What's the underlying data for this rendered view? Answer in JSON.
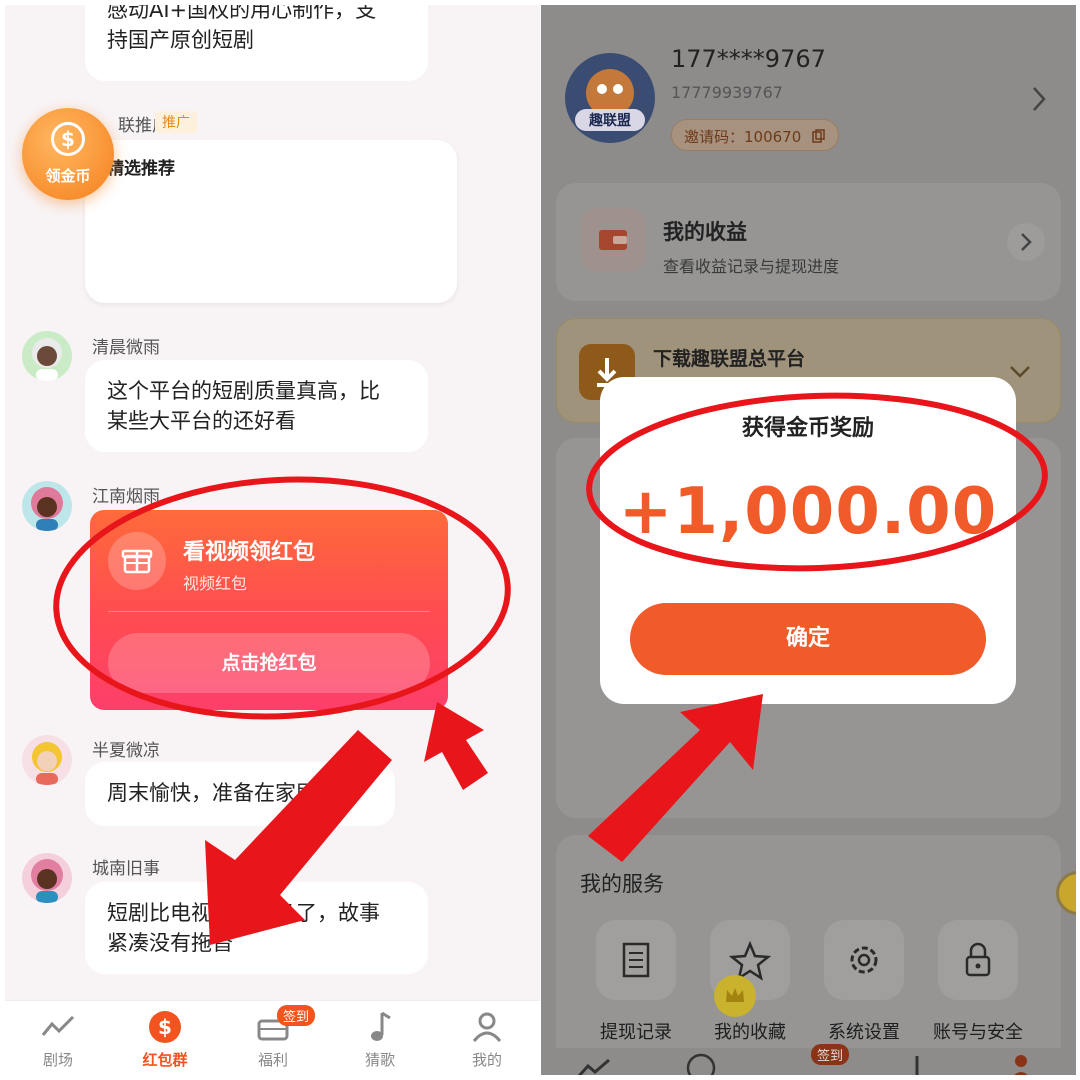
{
  "left": {
    "messages": [
      {
        "user": "",
        "text": "感动AI+国权的用心制作，支持国产原创短剧",
        "text_line2": "持国产原创短剧"
      },
      {
        "user": "联推广",
        "tag": "推广",
        "text": "精选推荐"
      },
      {
        "user": "清晨微雨",
        "text_line1": "这个平台的短剧质量真高，比",
        "text_line2": "某些大平台的还好看"
      },
      {
        "user": "江南烟雨"
      },
      {
        "user": "半夏微凉",
        "text": "周末愉快，准备在家刷短剧"
      },
      {
        "user": "城南旧事",
        "text_line1": "短剧比电视剧好看多了，故事",
        "text_line2": "紧凑没有拖沓"
      }
    ],
    "coin_fab": {
      "symbol": "$",
      "label": "领金币"
    },
    "red_packet": {
      "title": "看视频领红包",
      "subtitle": "视频红包",
      "button": "点击抢红包"
    },
    "tabs": [
      {
        "label": "剧场",
        "icon": "trend-icon"
      },
      {
        "label": "红包群",
        "icon": "dollar-icon",
        "active": true
      },
      {
        "label": "福利",
        "icon": "ticket-icon",
        "badge": "签到"
      },
      {
        "label": "猜歌",
        "icon": "music-note-icon"
      },
      {
        "label": "我的",
        "icon": "person-icon"
      }
    ]
  },
  "right": {
    "profile": {
      "phone_masked": "177****9767",
      "phone": "17779939767",
      "avatar_text": "趣联盟",
      "invite_code": "邀请码：100670"
    },
    "earnings": {
      "title": "我的收益",
      "subtitle": "查看收益记录与提现进度"
    },
    "download": {
      "title": "下载趣联盟总平台"
    },
    "services": {
      "title": "我的服务",
      "items": [
        "提现记录",
        "我的收藏",
        "系统设置",
        "账号与安全"
      ]
    },
    "bottom_badge": "签到"
  },
  "modal": {
    "title": "获得金币奖励",
    "amount": "+1,000.00",
    "confirm": "确定"
  },
  "colors": {
    "accent": "#f15b2a",
    "annotation_red": "#e8161b",
    "promo_tag": "#e8891c"
  }
}
